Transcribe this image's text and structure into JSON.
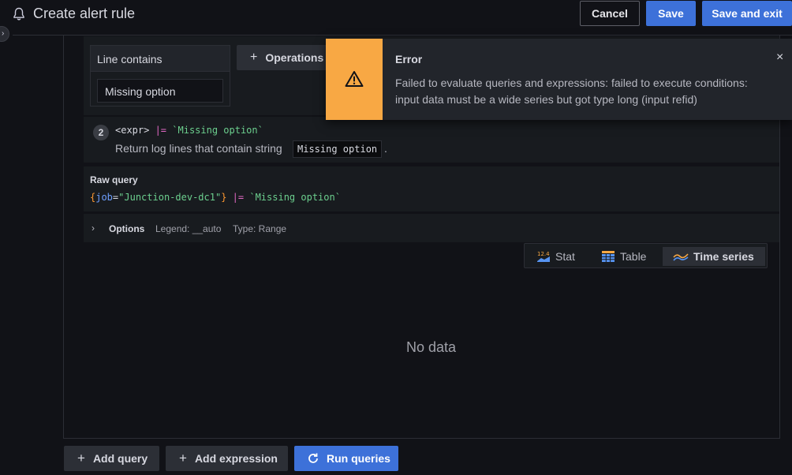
{
  "header": {
    "title": "Create alert rule",
    "cancel_label": "Cancel",
    "save_label": "Save",
    "save_exit_label": "Save and exit"
  },
  "query_builder": {
    "operation_title": "Line contains",
    "operation_value": "Missing option",
    "operations_label": "Operations"
  },
  "hint": {
    "number": "2",
    "code_expr": "<expr>",
    "code_op": " |= ",
    "code_str": "`Missing option`",
    "text": "Return log lines that contain string",
    "chip": "Missing option",
    "dot": "."
  },
  "raw_query": {
    "title": "Raw query",
    "brace_open": "{",
    "label": "job",
    "eq": "=",
    "label_value": "\"Junction-dev-dc1\"",
    "brace_close": "}",
    "op": " |= ",
    "str": "`Missing option`"
  },
  "options": {
    "label": "Options",
    "legend": "Legend: __auto",
    "type": "Type: Range"
  },
  "viz": {
    "stat_label": "Stat",
    "table_label": "Table",
    "timeseries_label": "Time series",
    "selected": "Time series"
  },
  "panel": {
    "empty_text": "No data"
  },
  "footer": {
    "add_query_label": "Add query",
    "add_expression_label": "Add expression",
    "run_queries_label": "Run queries"
  },
  "toast": {
    "title": "Error",
    "message": "Failed to evaluate queries and expressions: failed to execute conditions: input data must be a wide series but got type long (input refid)",
    "close": "×"
  },
  "colors": {
    "accent": "#3d71d9",
    "warning": "#f8a844"
  }
}
